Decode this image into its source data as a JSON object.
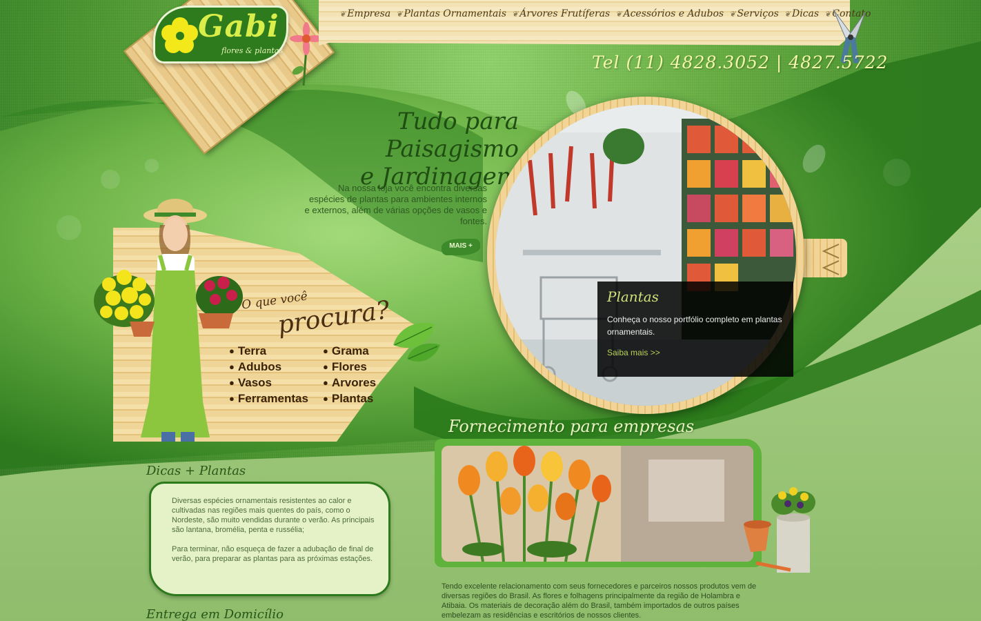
{
  "logo": {
    "name": "Gabi",
    "subtitle": "flores & plantas"
  },
  "nav": {
    "items": [
      {
        "label": "Empresa"
      },
      {
        "label": "Plantas Ornamentais"
      },
      {
        "label": "Árvores Frutíferas"
      },
      {
        "label": "Acessórios e Adubos"
      },
      {
        "label": "Serviços"
      },
      {
        "label": "Dicas"
      },
      {
        "label": "Contato"
      }
    ]
  },
  "contact": {
    "phone": "Tel (11) 4828.3052 | 4827.5722"
  },
  "hero": {
    "title_line1": "Tudo para Paisagismo",
    "title_line2": "e Jardinagem",
    "text": "Na nossa loja você encontra diversas espécies de plantas para ambientes internos e externos, além de várias opções de vasos e fontes.",
    "more_label": "MAIS +"
  },
  "slider": {
    "caption_title": "Plantas",
    "caption_text": "Conheça o nosso portfólio completo em plantas ornamentais.",
    "caption_link": "Saiba mais >>"
  },
  "search": {
    "question_small": "O que você",
    "question_big": "procura?",
    "categories": [
      "Terra",
      "Grama",
      "Adubos",
      "Flores",
      "Vasos",
      "Arvores",
      "Ferramentas",
      "Plantas"
    ]
  },
  "dicas": {
    "title": "Dicas + Plantas",
    "paragraph1": "Diversas espécies ornamentais resistentes ao calor e cultivadas nas regiões mais quentes do país, como o Nordeste, são muito vendidas durante o verão. As principais são lantana, bromélia, penta e russélia;",
    "paragraph2": "Para terminar, não esqueça de fazer a adubação de final de verão, para preparar as plantas para as próximas estações."
  },
  "entrega": {
    "title": "Entrega em Domicílio"
  },
  "fornecimento": {
    "title": "Fornecimento para empresas",
    "text": "Tendo excelente relacionamento com seus fornecedores e parceiros nossos produtos vem de diversas regiões do Brasil. As flores e folhagens principalmente da região de Holambra e Atibaia. Os materiais de decoração além do Brasil, também importados de outros países embelezam as residências e escritórios de nossos clientes."
  },
  "colors": {
    "dark_green": "#2e7b1d",
    "light_green": "#e5f2c8",
    "wood": "#f0d598",
    "accent_yellow": "#d9ee4a"
  }
}
